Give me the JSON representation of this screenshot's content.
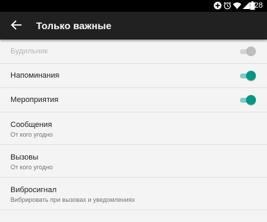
{
  "status_bar": {
    "time": "1:28",
    "icons": [
      "add-circle-icon",
      "alarm-icon",
      "wifi-icon",
      "signal-icon",
      "battery-icon"
    ]
  },
  "app_bar": {
    "back_icon": "arrow-back-icon",
    "title": "Только важные"
  },
  "settings": [
    {
      "label": "Будильник",
      "enabled": false,
      "checked": true
    },
    {
      "label": "Напоминания",
      "enabled": true,
      "checked": true
    },
    {
      "label": "Мероприятия",
      "enabled": true,
      "checked": true
    },
    {
      "label": "Сообщения",
      "summary": "От кого угодно"
    },
    {
      "label": "Вызовы",
      "summary": "От кого угодно"
    },
    {
      "label": "Вибросигнал",
      "summary": "Вибрировать при вызовах и уведомлениях"
    }
  ],
  "colors": {
    "accent": "#009688",
    "accent_track": "#80cbc4",
    "app_bar": "#212121",
    "status_bar": "#000000",
    "background": "#f4f4f4"
  }
}
